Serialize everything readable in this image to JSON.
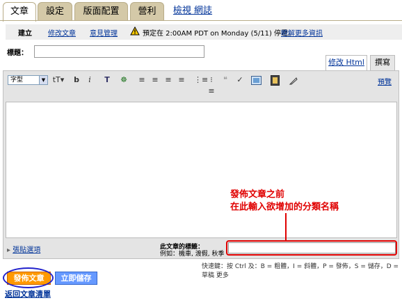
{
  "tabs": [
    {
      "label": "文章"
    },
    {
      "label": "設定"
    },
    {
      "label": "版面配置"
    },
    {
      "label": "營利"
    },
    {
      "label": "檢視 網誌"
    }
  ],
  "subnav": {
    "create": "建立",
    "edit_posts": "修改文章",
    "comments": "意見管理",
    "notice": "預定在 2:00AM PDT on Monday (5/11) 停電。",
    "learn_more": "瞭解更多資訊"
  },
  "title_label": "標題：",
  "title_value": "",
  "editor_tabs": {
    "edit_html": "修改 Html",
    "compose": "撰寫"
  },
  "toolbar": {
    "font": "字型",
    "preview": "預覽"
  },
  "labels": {
    "title": "此文章的標籤：",
    "example": "例如：機車, 渡假, 秋季",
    "value": ""
  },
  "post_options": "張貼選項",
  "annotation": {
    "line1": "發佈文章之前",
    "line2": "在此輸入欲增加的分類名稱"
  },
  "shortcuts": "快速鍵：按 Ctrl 及：B = 粗體，I = 斜體，P = 發佈，S = 儲存，D = 草稿 更多",
  "buttons": {
    "publish": "發佈文章",
    "save": "立即儲存"
  },
  "back_link": "返回文章清單",
  "colors": {
    "tab_bg": "#d4c9a8",
    "annotation": "#e00000",
    "publish": "#ff9900",
    "save": "#6699ff",
    "link": "#003399"
  }
}
